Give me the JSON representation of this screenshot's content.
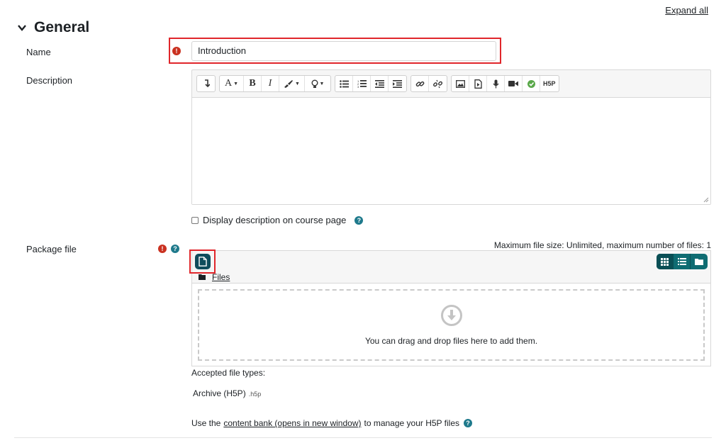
{
  "header": {
    "expand_all": "Expand all",
    "section_title": "General"
  },
  "name_field": {
    "label": "Name",
    "value": "Introduction"
  },
  "description": {
    "label": "Description",
    "toolbar": {
      "groups": [
        [
          "collapse-icon"
        ],
        [
          "font-style-icon",
          "bold-icon",
          "italic-icon",
          "color-icon",
          "lightbulb-icon"
        ],
        [
          "unordered-list-icon",
          "ordered-list-icon",
          "outdent-icon",
          "indent-icon"
        ],
        [
          "link-icon",
          "unlink-icon"
        ],
        [
          "image-icon",
          "media-icon",
          "record-audio-icon",
          "record-video-icon",
          "manage-files-icon",
          "h5p-icon"
        ]
      ],
      "bold": "B",
      "italic": "I",
      "h5p": "H5P"
    },
    "display_on_course_page": "Display description on course page"
  },
  "package_file": {
    "label": "Package file",
    "max_size": "Maximum file size: Unlimited, maximum number of files: 1",
    "path_folder": "Files",
    "drop_text": "You can drag and drop files here to add them.",
    "accepted_label": "Accepted file types:",
    "accepted_type": "Archive (H5P)",
    "accepted_ext": ".h5p",
    "use_prefix": "Use the",
    "content_bank_link": "content bank (opens in new window)",
    "use_suffix": "to manage your H5P files"
  },
  "colors": {
    "required": "#ca3120",
    "help": "#1f7a8c",
    "accent": "#0f4c5c",
    "highlight": "#e0262b"
  }
}
